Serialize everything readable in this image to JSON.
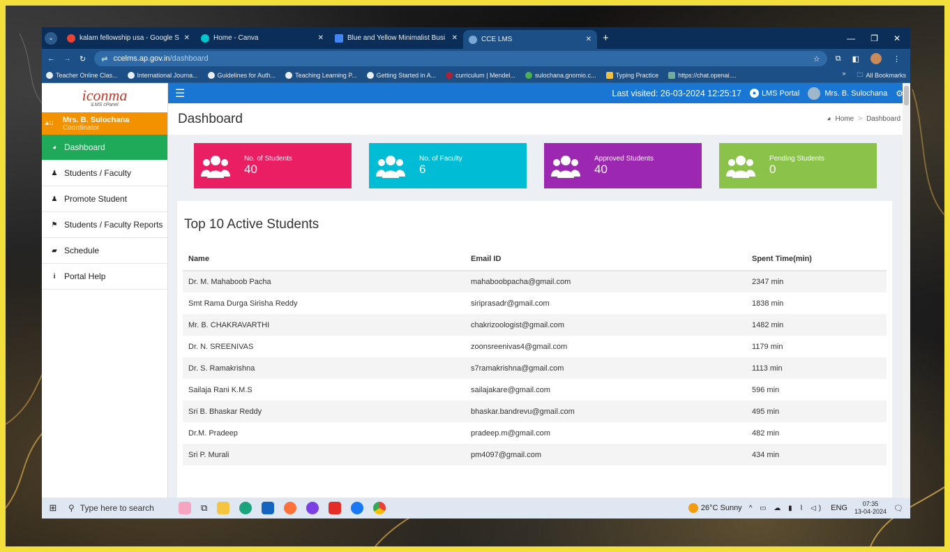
{
  "browser": {
    "tabs": [
      {
        "title": "kalam fellowship usa - Google S",
        "color": "#ea4335"
      },
      {
        "title": "Home - Canva",
        "color": "#00c4cc"
      },
      {
        "title": "Blue and Yellow Minimalist Busi",
        "color": "#4285f4"
      },
      {
        "title": "CCE LMS",
        "color": "#7aa7d6"
      }
    ],
    "url_host": "ccelms.ap.gov.in",
    "url_path": "/dashboard",
    "bookmarks": [
      "Teacher Online Clas...",
      "International Journa...",
      "Guidelines for Auth...",
      "Teaching Learning P...",
      "Getting Started in A...",
      "curriculum | Mendel...",
      "sulochana.gnomio.c...",
      "Typing Practice",
      "https://chat.openai...."
    ],
    "all_bookmarks": "All Bookmarks"
  },
  "logo": {
    "name": "iconma",
    "sub": "iLMS cPanel"
  },
  "user": {
    "name": "Mrs. B. Sulochana",
    "role": "Coordinator",
    "img_alt": "U"
  },
  "topnav": {
    "last_visited": "Last visited: 26-03-2024 12:25:17",
    "portal": "LMS Portal",
    "user": "Mrs. B. Sulochana"
  },
  "sidebar": {
    "items": [
      {
        "label": "Dashboard",
        "icon": "dashboard-icon",
        "active": true
      },
      {
        "label": "Students / Faculty",
        "icon": "user-icon"
      },
      {
        "label": "Promote Student",
        "icon": "user-icon"
      },
      {
        "label": "Students / Faculty Reports",
        "icon": "flag-icon"
      },
      {
        "label": "Schedule",
        "icon": "book-icon"
      },
      {
        "label": "Portal Help",
        "icon": "info-icon"
      }
    ]
  },
  "page": {
    "title": "Dashboard",
    "breadcrumb_home": "Home",
    "breadcrumb_current": "Dashboard"
  },
  "stats": [
    {
      "label": "No. of Students",
      "value": "40",
      "color": "#e91e63"
    },
    {
      "label": "No. of Faculty",
      "value": "6",
      "color": "#00bcd4"
    },
    {
      "label": "Approved Students",
      "value": "40",
      "color": "#9c27b0"
    },
    {
      "label": "Pending Students",
      "value": "0",
      "color": "#8bc34a"
    }
  ],
  "table": {
    "title": "Top 10 Active Students",
    "headers": [
      "Name",
      "Email ID",
      "Spent Time(min)"
    ],
    "rows": [
      [
        "Dr. M. Mahaboob Pacha",
        "mahaboobpacha@gmail.com",
        "2347 min"
      ],
      [
        "Smt Rama Durga Sirisha Reddy",
        "siriprasadr@gmail.com",
        "1838 min"
      ],
      [
        "Mr. B. CHAKRAVARTHI",
        "chakrizoologist@gmail.com",
        "1482 min"
      ],
      [
        "Dr. N. SREENIVAS",
        "zoonsreenivas4@gmail.com",
        "1179 min"
      ],
      [
        "Dr. S. Ramakrishna",
        "s7ramakrishna@gmail.com",
        "1113 min"
      ],
      [
        "Sailaja Rani K.M.S",
        "sailajakare@gmail.com",
        "596 min"
      ],
      [
        "Sri B. Bhaskar Reddy",
        "bhaskar.bandrevu@gmail.com",
        "495 min"
      ],
      [
        "Dr.M. Pradeep",
        "pradeep.m@gmail.com",
        "482 min"
      ],
      [
        "Sri P. Murali",
        "pm4097@gmail.com",
        "434 min"
      ]
    ]
  },
  "taskbar": {
    "search_placeholder": "Type here to search",
    "weather": "26°C  Sunny",
    "lang": "ENG",
    "time": "07:35",
    "date": "13-04-2024"
  }
}
